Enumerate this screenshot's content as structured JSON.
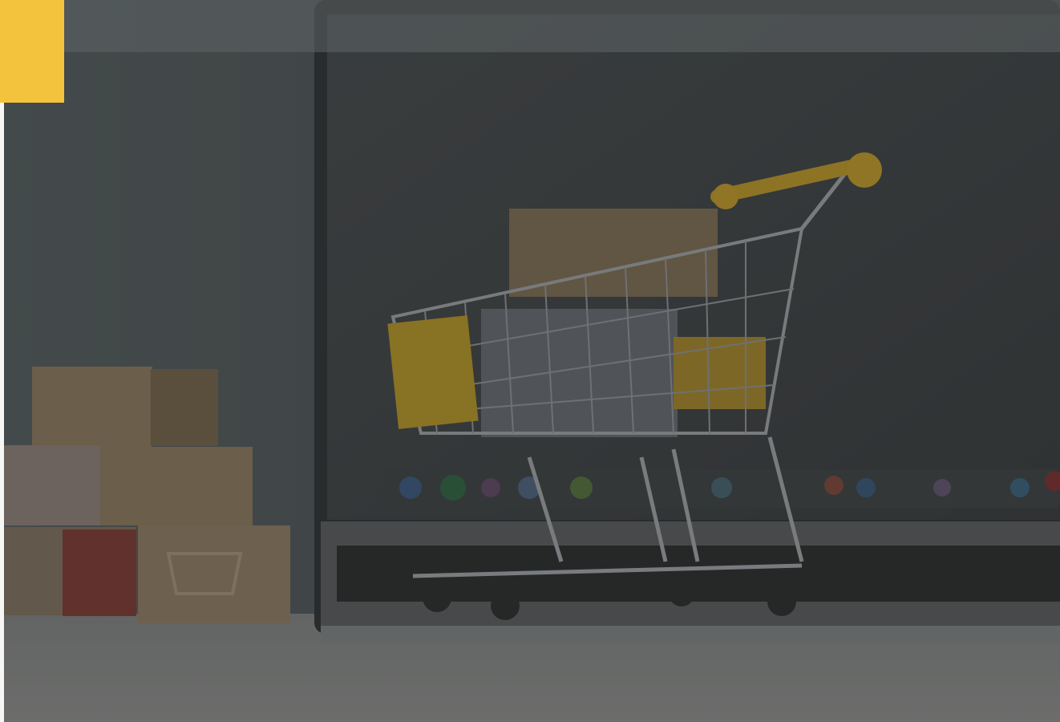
{
  "page": {
    "hero_image": "shopping-cart-on-laptop-photo",
    "overlay_color": "#2b2d2e",
    "accent_color": "#f4c33d"
  },
  "header": {
    "logo_icon": "brand-logo-block"
  }
}
